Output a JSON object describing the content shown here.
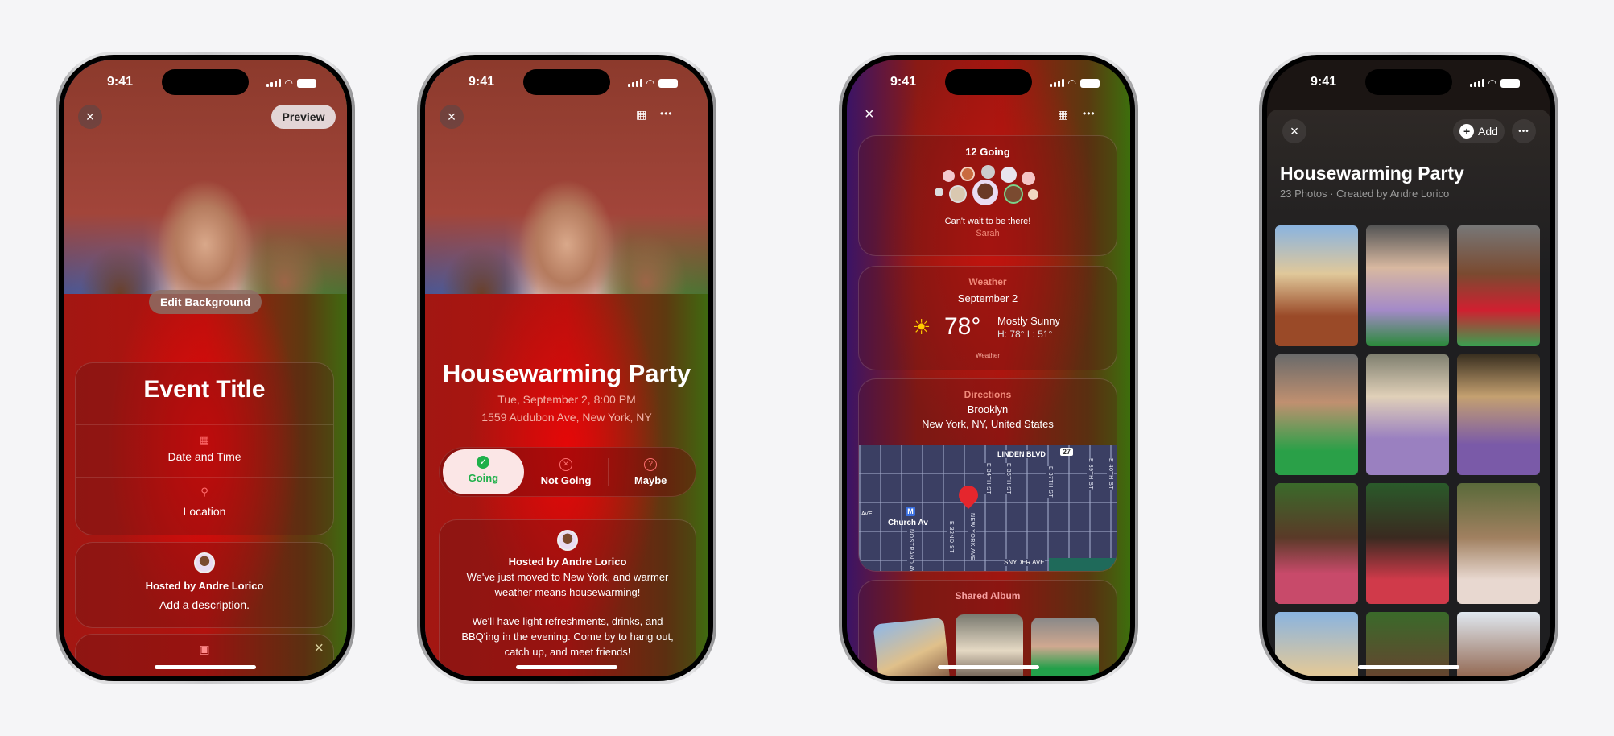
{
  "status_time": "9:41",
  "phone1": {
    "close": "×",
    "preview": "Preview",
    "edit_background": "Edit Background",
    "event_title": "Event Title",
    "date_time": "Date and Time",
    "location": "Location",
    "hosted_by": "Hosted by Andre Lorico",
    "description": "Add a description.",
    "dismiss": "×"
  },
  "phone2": {
    "close": "×",
    "more": "•••",
    "title": "Housewarming Party",
    "datetime": "Tue, September 2, 8:00 PM",
    "address": "1559 Audubon Ave, New York, NY",
    "rsvp": [
      {
        "label": "Going",
        "icon": "✓",
        "selected": true
      },
      {
        "label": "Not Going",
        "icon": "✕",
        "selected": false
      },
      {
        "label": "Maybe",
        "icon": "?",
        "selected": false
      }
    ],
    "hosted_by": "Hosted by Andre Lorico",
    "desc1": "We've just moved to New York, and warmer weather means housewarming!",
    "desc2": "We'll have light refreshments, drinks, and BBQ'ing in the evening. Come by to hang out, catch up, and meet friends!"
  },
  "phone3": {
    "close": "×",
    "more": "•••",
    "going": "12 Going",
    "comment": "Can't wait to be there!",
    "commenter": "Sarah",
    "weather": {
      "label": "Weather",
      "date": "September 2",
      "temp": "78°",
      "condition": "Mostly Sunny",
      "hilo": "H: 78° L: 51°",
      "attribution": "Weather"
    },
    "directions": {
      "label": "Directions",
      "place": "Brooklyn",
      "region": "New York, NY, United States"
    },
    "map": {
      "linden": "LINDEN BLVD",
      "route": "27",
      "church": "Church Av",
      "metro": "M",
      "snyder": "SNYDER AVE",
      "ave": "AVE",
      "streets": [
        "NOSTRAND AV",
        "E 32ND ST",
        "NEW YORK AVE",
        "E 34TH ST",
        "E 36TH ST",
        "E 37TH ST",
        "E 39TH ST",
        "E 40TH ST"
      ]
    },
    "album_label": "Shared Album"
  },
  "phone4": {
    "close": "×",
    "add": "Add",
    "more": "•••",
    "title": "Housewarming Party",
    "subtitle": "23 Photos · Created by Andre Lorico"
  },
  "colors": {
    "accent_red": "#e10a0a",
    "going_green": "#1fb04a",
    "weather_label": "#f08a7a"
  }
}
